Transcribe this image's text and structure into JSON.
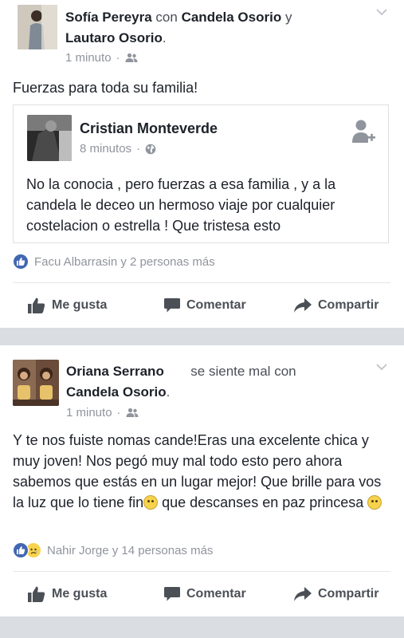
{
  "post1": {
    "author": "Sofía Pereyra",
    "con_word": "con",
    "tag1": "Candela Osorio",
    "y_word": "y",
    "tag2": "Lautaro Osorio",
    "tag2_period": ".",
    "time": "1 minuto",
    "dot": "·",
    "privacy_icon": "friends-icon",
    "text": "Fuerzas para toda su familia!",
    "shared": {
      "author": "Cristian Monteverde",
      "time": "8 minutos",
      "dot": "·",
      "privacy_icon": "globe-icon",
      "text": "No la conocia , pero fuerzas a esa familia , y a la candela le deceo un hermoso viaje por cualquier costelacion o estrella  ! Que tristesa esto"
    },
    "reactions_text": "Facu Albarrasin y 2 personas más",
    "actions": {
      "like": "Me gusta",
      "comment": "Comentar",
      "share": "Compartir"
    }
  },
  "post2": {
    "author": "Oriana Serrano",
    "feeling": "se siente mal",
    "con_word": "con",
    "tag1": "Candela Osorio",
    "tag1_period": ".",
    "time": "1 minuto",
    "dot": "·",
    "privacy_icon": "friends-icon",
    "text_part1": "Y te nos fuiste nomas cande!Eras una excelente chica y muy joven! Nos pegó muy mal todo esto pero ahora sabemos que estás en un lugar mejor! Que brille para vos la luz que lo tiene fin",
    "text_part2": " que descanses en paz princesa ",
    "reactions_text": "Nahir Jorge y 14 personas más",
    "actions": {
      "like": "Me gusta",
      "comment": "Comentar",
      "share": "Compartir"
    }
  },
  "colors": {
    "fb_blue": "#4267b2",
    "sad_yellow": "#f7d34d",
    "separator": "#dadde1",
    "meta_gray": "#90949c"
  }
}
